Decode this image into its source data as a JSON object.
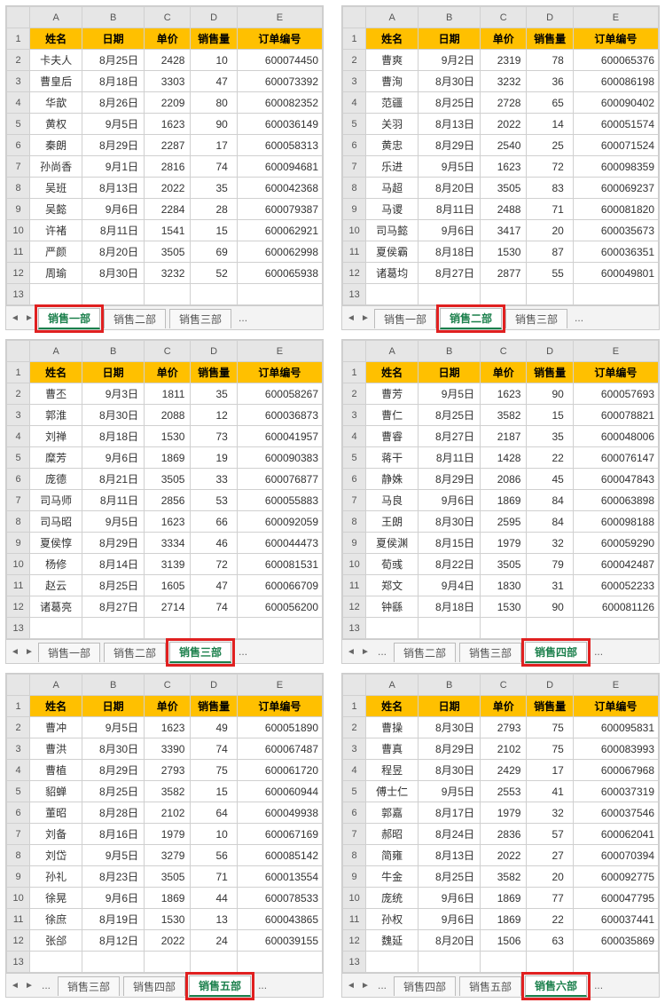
{
  "columns_letters": [
    "A",
    "B",
    "C",
    "D",
    "E"
  ],
  "headers": [
    "姓名",
    "日期",
    "单价",
    "销售量",
    "订单编号"
  ],
  "sheets": [
    {
      "tabs": [
        "销售一部",
        "销售二部",
        "销售三部"
      ],
      "active_index": 0,
      "highlight_index": 0,
      "leading_ellipsis": false,
      "rows": [
        [
          "卡夫人",
          "8月25日",
          "2428",
          "10",
          "600074450"
        ],
        [
          "曹皇后",
          "8月18日",
          "3303",
          "47",
          "600073392"
        ],
        [
          "华歆",
          "8月26日",
          "2209",
          "80",
          "600082352"
        ],
        [
          "黄权",
          "9月5日",
          "1623",
          "90",
          "600036149"
        ],
        [
          "秦朗",
          "8月29日",
          "2287",
          "17",
          "600058313"
        ],
        [
          "孙尚香",
          "9月1日",
          "2816",
          "74",
          "600094681"
        ],
        [
          "吴班",
          "8月13日",
          "2022",
          "35",
          "600042368"
        ],
        [
          "吴懿",
          "9月6日",
          "2284",
          "28",
          "600079387"
        ],
        [
          "许褚",
          "8月11日",
          "1541",
          "15",
          "600062921"
        ],
        [
          "严颜",
          "8月20日",
          "3505",
          "69",
          "600062998"
        ],
        [
          "周瑜",
          "8月30日",
          "3232",
          "52",
          "600065938"
        ]
      ]
    },
    {
      "tabs": [
        "销售一部",
        "销售二部",
        "销售三部"
      ],
      "active_index": 1,
      "highlight_index": 1,
      "leading_ellipsis": false,
      "rows": [
        [
          "曹爽",
          "9月2日",
          "2319",
          "78",
          "600065376"
        ],
        [
          "曹洵",
          "8月30日",
          "3232",
          "36",
          "600086198"
        ],
        [
          "范疆",
          "8月25日",
          "2728",
          "65",
          "600090402"
        ],
        [
          "关羽",
          "8月13日",
          "2022",
          "14",
          "600051574"
        ],
        [
          "黄忠",
          "8月29日",
          "2540",
          "25",
          "600071524"
        ],
        [
          "乐进",
          "9月5日",
          "1623",
          "72",
          "600098359"
        ],
        [
          "马超",
          "8月20日",
          "3505",
          "83",
          "600069237"
        ],
        [
          "马谡",
          "8月11日",
          "2488",
          "71",
          "600081820"
        ],
        [
          "司马懿",
          "9月6日",
          "3417",
          "20",
          "600035673"
        ],
        [
          "夏侯霸",
          "8月18日",
          "1530",
          "87",
          "600036351"
        ],
        [
          "诸葛均",
          "8月27日",
          "2877",
          "55",
          "600049801"
        ]
      ]
    },
    {
      "tabs": [
        "销售一部",
        "销售二部",
        "销售三部"
      ],
      "active_index": 2,
      "highlight_index": 2,
      "leading_ellipsis": false,
      "rows": [
        [
          "曹丕",
          "9月3日",
          "1811",
          "35",
          "600058267"
        ],
        [
          "郭淮",
          "8月30日",
          "2088",
          "12",
          "600036873"
        ],
        [
          "刘禅",
          "8月18日",
          "1530",
          "73",
          "600041957"
        ],
        [
          "糜芳",
          "9月6日",
          "1869",
          "19",
          "600090383"
        ],
        [
          "庞德",
          "8月21日",
          "3505",
          "33",
          "600076877"
        ],
        [
          "司马师",
          "8月11日",
          "2856",
          "53",
          "600055883"
        ],
        [
          "司马昭",
          "9月5日",
          "1623",
          "66",
          "600092059"
        ],
        [
          "夏侯惇",
          "8月29日",
          "3334",
          "46",
          "600044473"
        ],
        [
          "杨修",
          "8月14日",
          "3139",
          "72",
          "600081531"
        ],
        [
          "赵云",
          "8月25日",
          "1605",
          "47",
          "600066709"
        ],
        [
          "诸葛亮",
          "8月27日",
          "2714",
          "74",
          "600056200"
        ]
      ]
    },
    {
      "tabs": [
        "销售二部",
        "销售三部",
        "销售四部"
      ],
      "active_index": 2,
      "highlight_index": 2,
      "leading_ellipsis": true,
      "rows": [
        [
          "曹芳",
          "9月5日",
          "1623",
          "90",
          "600057693"
        ],
        [
          "曹仁",
          "8月25日",
          "3582",
          "15",
          "600078821"
        ],
        [
          "曹睿",
          "8月27日",
          "2187",
          "35",
          "600048006"
        ],
        [
          "蒋干",
          "8月11日",
          "1428",
          "22",
          "600076147"
        ],
        [
          "静姝",
          "8月29日",
          "2086",
          "45",
          "600047843"
        ],
        [
          "马良",
          "9月6日",
          "1869",
          "84",
          "600063898"
        ],
        [
          "王朗",
          "8月30日",
          "2595",
          "84",
          "600098188"
        ],
        [
          "夏侯渊",
          "8月15日",
          "1979",
          "32",
          "600059290"
        ],
        [
          "荀彧",
          "8月22日",
          "3505",
          "79",
          "600042487"
        ],
        [
          "郑文",
          "9月4日",
          "1830",
          "31",
          "600052233"
        ],
        [
          "钟繇",
          "8月18日",
          "1530",
          "90",
          "600081126"
        ]
      ]
    },
    {
      "tabs": [
        "销售三部",
        "销售四部",
        "销售五部"
      ],
      "active_index": 2,
      "highlight_index": 2,
      "leading_ellipsis": true,
      "rows": [
        [
          "曹冲",
          "9月5日",
          "1623",
          "49",
          "600051890"
        ],
        [
          "曹洪",
          "8月30日",
          "3390",
          "74",
          "600067487"
        ],
        [
          "曹植",
          "8月29日",
          "2793",
          "75",
          "600061720"
        ],
        [
          "貂蝉",
          "8月25日",
          "3582",
          "15",
          "600060944"
        ],
        [
          "董昭",
          "8月28日",
          "2102",
          "64",
          "600049938"
        ],
        [
          "刘备",
          "8月16日",
          "1979",
          "10",
          "600067169"
        ],
        [
          "刘岱",
          "9月5日",
          "3279",
          "56",
          "600085142"
        ],
        [
          "孙礼",
          "8月23日",
          "3505",
          "71",
          "600013554"
        ],
        [
          "徐晃",
          "9月6日",
          "1869",
          "44",
          "600078533"
        ],
        [
          "徐庶",
          "8月19日",
          "1530",
          "13",
          "600043865"
        ],
        [
          "张郃",
          "8月12日",
          "2022",
          "24",
          "600039155"
        ]
      ]
    },
    {
      "tabs": [
        "销售四部",
        "销售五部",
        "销售六部"
      ],
      "active_index": 2,
      "highlight_index": 2,
      "leading_ellipsis": true,
      "rows": [
        [
          "曹操",
          "8月30日",
          "2793",
          "75",
          "600095831"
        ],
        [
          "曹真",
          "8月29日",
          "2102",
          "75",
          "600083993"
        ],
        [
          "程昱",
          "8月30日",
          "2429",
          "17",
          "600067968"
        ],
        [
          "傅士仁",
          "9月5日",
          "2553",
          "41",
          "600037319"
        ],
        [
          "郭嘉",
          "8月17日",
          "1979",
          "32",
          "600037546"
        ],
        [
          "郝昭",
          "8月24日",
          "2836",
          "57",
          "600062041"
        ],
        [
          "简雍",
          "8月13日",
          "2022",
          "27",
          "600070394"
        ],
        [
          "牛金",
          "8月25日",
          "3582",
          "20",
          "600092775"
        ],
        [
          "庞统",
          "9月6日",
          "1869",
          "77",
          "600047795"
        ],
        [
          "孙权",
          "9月6日",
          "1869",
          "22",
          "600037441"
        ],
        [
          "魏延",
          "8月20日",
          "1506",
          "63",
          "600035869"
        ]
      ]
    }
  ],
  "more_label": "...",
  "nav_left": "◄",
  "nav_right": "►"
}
